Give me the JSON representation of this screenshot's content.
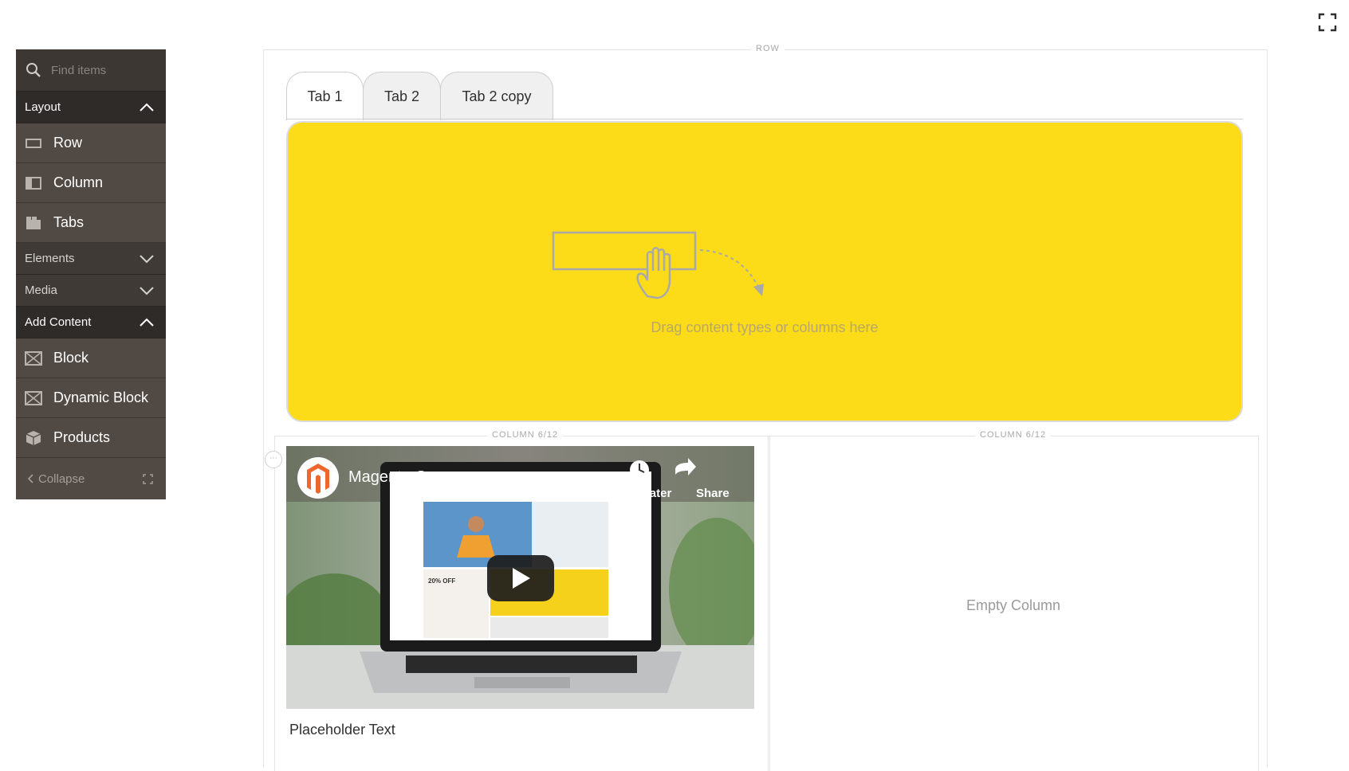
{
  "search": {
    "placeholder": "Find items"
  },
  "panel": {
    "layout_label": "Layout",
    "layout_items": [
      "Row",
      "Column",
      "Tabs"
    ],
    "elements_label": "Elements",
    "media_label": "Media",
    "add_content_label": "Add Content",
    "add_content_items": [
      "Block",
      "Dynamic Block",
      "Products"
    ],
    "collapse_label": "Collapse"
  },
  "stage": {
    "row_label": "ROW",
    "tabs": [
      "Tab 1",
      "Tab 2",
      "Tab 2 copy"
    ],
    "drop_hint": "Drag content types or columns here",
    "columns": [
      {
        "label": "COLUMN 6/12"
      },
      {
        "label": "COLUMN 6/12",
        "empty_text": "Empty Column"
      }
    ],
    "video": {
      "title": "Magento Commerce",
      "watch_later": "Watch later",
      "share": "Share",
      "promo_off": "20% OFF"
    },
    "placeholder_text": "Placeholder Text"
  },
  "colors": {
    "tab_area": "#fcdb18",
    "panel_bg": "#514943"
  }
}
